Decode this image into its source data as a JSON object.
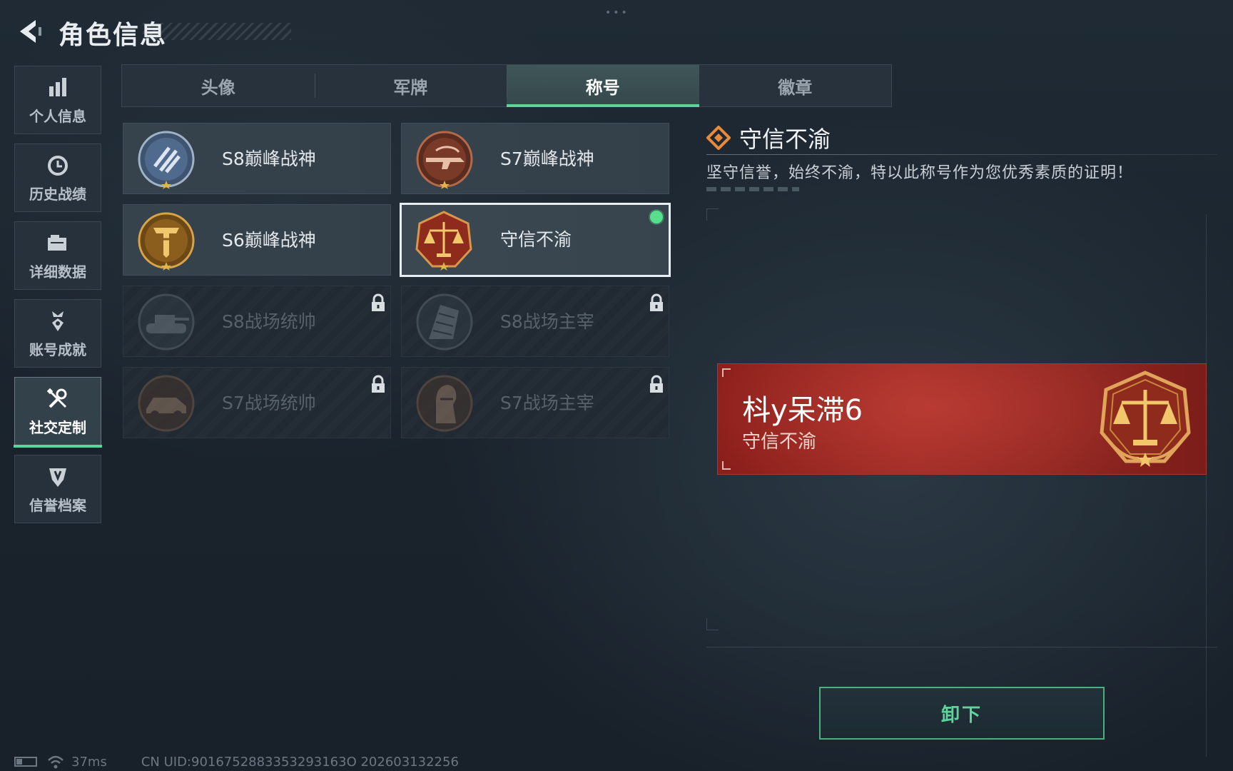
{
  "header": {
    "title": "角色信息"
  },
  "side_nav": {
    "items": [
      {
        "label": "个人信息",
        "icon": "bar-chart-icon",
        "active": false
      },
      {
        "label": "历史战绩",
        "icon": "clock-history-icon",
        "active": false
      },
      {
        "label": "详细数据",
        "icon": "folder-data-icon",
        "active": false
      },
      {
        "label": "账号成就",
        "icon": "achievement-medal-icon",
        "active": false
      },
      {
        "label": "社交定制",
        "icon": "wrench-screwdriver-icon",
        "active": true
      },
      {
        "label": "信誉档案",
        "icon": "credit-shield-icon",
        "active": false
      }
    ]
  },
  "tabs": [
    {
      "label": "头像",
      "active": false
    },
    {
      "label": "军牌",
      "active": false
    },
    {
      "label": "称号",
      "active": true
    },
    {
      "label": "徽章",
      "active": false
    }
  ],
  "titles": [
    {
      "name": "S8巅峰战神",
      "emblem": "s8-peak-emblem-icon",
      "locked": false,
      "selected": false,
      "equipped": false
    },
    {
      "name": "S7巅峰战神",
      "emblem": "s7-peak-emblem-icon",
      "locked": false,
      "selected": false,
      "equipped": false
    },
    {
      "name": "S6巅峰战神",
      "emblem": "s6-peak-emblem-icon",
      "locked": false,
      "selected": false,
      "equipped": false
    },
    {
      "name": "守信不渝",
      "emblem": "scales-emblem-icon",
      "locked": false,
      "selected": true,
      "equipped": true
    },
    {
      "name": "S8战场统帅",
      "emblem": "tank-emblem-icon",
      "locked": true,
      "selected": false,
      "equipped": false
    },
    {
      "name": "S8战场主宰",
      "emblem": "building-emblem-icon",
      "locked": true,
      "selected": false,
      "equipped": false
    },
    {
      "name": "S7战场统帅",
      "emblem": "vehicle-emblem-icon",
      "locked": true,
      "selected": false,
      "equipped": false
    },
    {
      "name": "S7战场主宰",
      "emblem": "soldier-emblem-icon",
      "locked": true,
      "selected": false,
      "equipped": false
    }
  ],
  "detail": {
    "name": "守信不渝",
    "description": "坚守信誉，始终不渝，特以此称号作为您优秀素质的证明！"
  },
  "banner": {
    "player_name": "枓y呆滞6",
    "title": "守信不渝"
  },
  "actions": {
    "unequip_label": "卸下"
  },
  "footer": {
    "ping": "37ms",
    "uid": "CN UID:9016752883353293163O 202603132256"
  },
  "colors": {
    "accent_green": "#5fd49a",
    "banner_red": "#9c2a24",
    "emblem_gold": "#c98a2e"
  }
}
